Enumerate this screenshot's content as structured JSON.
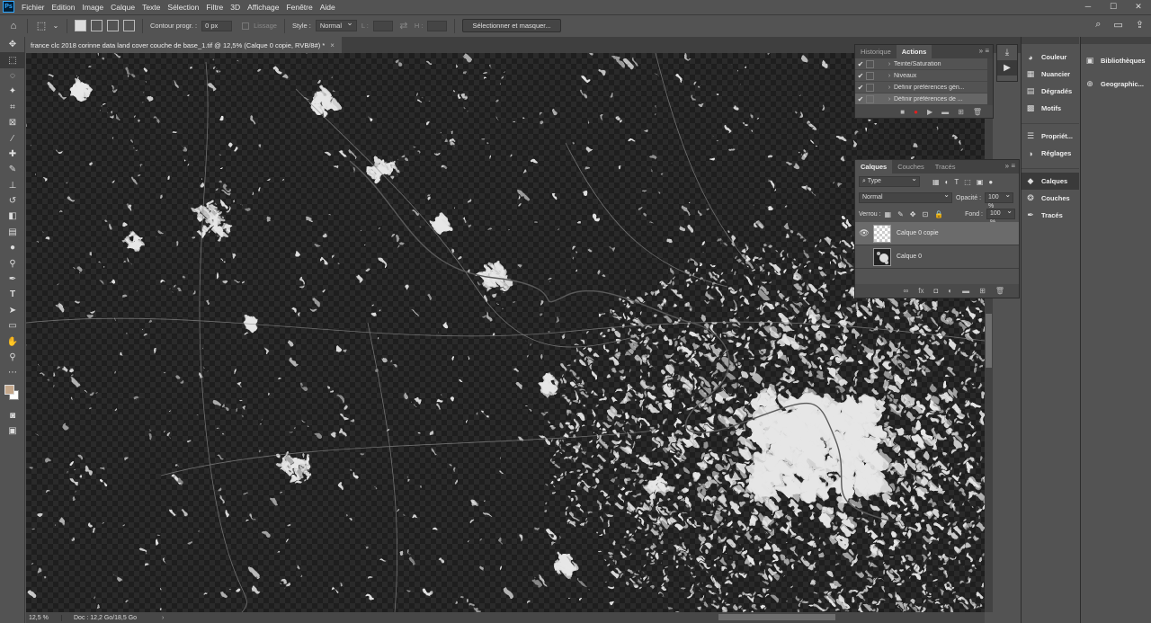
{
  "menu": [
    "Fichier",
    "Edition",
    "Image",
    "Calque",
    "Texte",
    "Sélection",
    "Filtre",
    "3D",
    "Affichage",
    "Fenêtre",
    "Aide"
  ],
  "options": {
    "feather_label": "Contour progr. :",
    "feather_value": "0 px",
    "antialias_label": "Lissage",
    "style_label": "Style :",
    "style_value": "Normal",
    "width_label": "L :",
    "height_label": "H :",
    "select_mask_button": "Sélectionner et masquer..."
  },
  "document": {
    "tab_title": "france clc 2018 corinne data land cover couche de base_1.tif @ 12,5% (Calque 0 copie, RVB/8#) *",
    "tab_close": "×"
  },
  "status": {
    "zoom": "12,5 %",
    "doc_info": "Doc : 12,2 Go/18,5 Go",
    "arrow": "›"
  },
  "actions_panel": {
    "tabs": [
      "Historique",
      "Actions"
    ],
    "active_tab": "Actions",
    "rows": [
      {
        "label": "Teinte/Saturation",
        "selected": false
      },
      {
        "label": "Niveaux",
        "selected": false
      },
      {
        "label": "Définir préférences gén...",
        "selected": false
      },
      {
        "label": "Définir préférences de ...",
        "selected": true
      }
    ]
  },
  "layers_panel": {
    "tabs": [
      "Calques",
      "Couches",
      "Tracés"
    ],
    "active_tab": "Calques",
    "filter_type": "Type",
    "blend_mode": "Normal",
    "opacity_label": "Opacité :",
    "opacity_value": "100 %",
    "lock_label": "Verrou :",
    "fill_label": "Fond :",
    "fill_value": "100 %",
    "layers": [
      {
        "name": "Calque 0 copie",
        "visible": true,
        "selected": true
      },
      {
        "name": "Calque 0",
        "visible": false,
        "selected": false
      }
    ]
  },
  "dock_panels": {
    "group1": [
      "Couleur",
      "Nuancier",
      "Dégradés",
      "Motifs"
    ],
    "group2": [
      "Propriét...",
      "Réglages"
    ],
    "group3": [
      "Calques",
      "Couches",
      "Tracés"
    ],
    "active": "Calques"
  },
  "libraries": [
    "Bibliothèques",
    "Geographic..."
  ],
  "colors": {
    "foreground": "#c4a78a",
    "background": "#ffffff",
    "record": "#e02020"
  }
}
